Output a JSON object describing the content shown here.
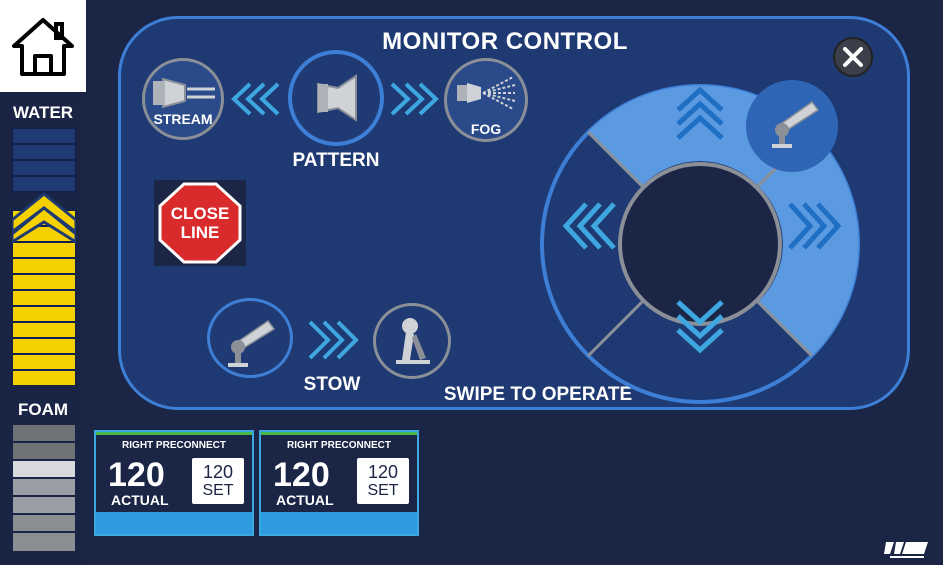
{
  "sidebar": {
    "water_label": "WATER",
    "foam_label": "FOAM",
    "colors": {
      "water_fill": "#f5d100",
      "foam_fill": "#d7d9de"
    }
  },
  "panel": {
    "title": "MONITOR  CONTROL",
    "pattern": {
      "stream_label": "STREAM",
      "pattern_label": "PATTERN",
      "fog_label": "FOG"
    },
    "close_line_label_1": "CLOSE",
    "close_line_label_2": "LINE",
    "stow_label": "STOW",
    "swipe_label": "SWIPE TO OPERATE"
  },
  "cards": [
    {
      "name": "RIGHT PRECONNECT",
      "actual_value": "120",
      "actual_label": "ACTUAL",
      "set_value": "120",
      "set_label": "SET"
    },
    {
      "name": "RIGHT PRECONNECT",
      "actual_value": "120",
      "actual_label": "ACTUAL",
      "set_value": "120",
      "set_label": "SET"
    }
  ],
  "colors": {
    "accent": "#3d7fd6",
    "panel_bg": "#1f3a73",
    "page_bg": "#1b2546",
    "joystick_light": "#5b9ae0"
  }
}
